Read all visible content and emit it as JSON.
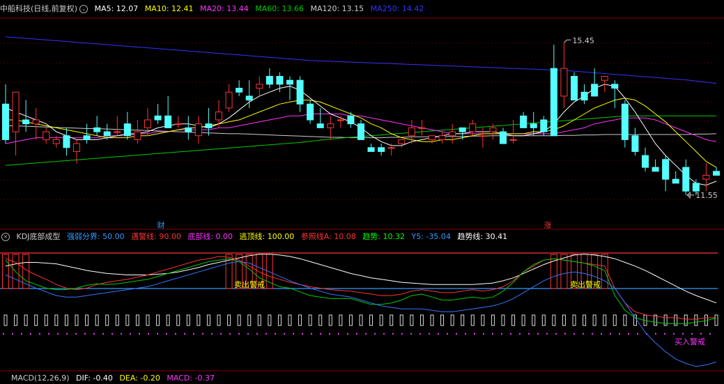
{
  "price_panel": {
    "title": "中船科技(日线,前复权)",
    "ma": [
      {
        "label": "MA5: 12.07",
        "color": "#ffffff"
      },
      {
        "label": "MA10: 12.41",
        "color": "#ffff00"
      },
      {
        "label": "MA20: 13.44",
        "color": "#ff33ff"
      },
      {
        "label": "MA60: 13.66",
        "color": "#00cc00"
      },
      {
        "label": "MA120: 13.15",
        "color": "#cccccc"
      },
      {
        "label": "MA250: 14.42",
        "color": "#3333ff"
      }
    ],
    "high_label": "15.45",
    "low_label": "11.55",
    "event_cai": "财",
    "event_zhang": "涨"
  },
  "kdj_panel": {
    "title": "KDJ底部成型",
    "params": [
      {
        "label": "强弱分界: 50.00",
        "color": "#3399ff"
      },
      {
        "label": "遇警线: 90.00",
        "color": "#ff3333"
      },
      {
        "label": "底部线: 0.00",
        "color": "#ff33ff"
      },
      {
        "label": "逃顶线: 100.00",
        "color": "#ffff00"
      },
      {
        "label": "参照线A: 10.08",
        "color": "#ff3333"
      },
      {
        "label": "趋势: 10.32",
        "color": "#00ff00"
      },
      {
        "label": "Y5: -35.04",
        "color": "#3399ff"
      },
      {
        "label": "趋势线: 30.41",
        "color": "#ffffff"
      }
    ],
    "sell_warn": "卖出警戒",
    "buy_warn": "买入警戒"
  },
  "macd_panel": {
    "title": "MACD(12,26,9)",
    "params": [
      {
        "label": "DIF: -0.40",
        "color": "#ffffff"
      },
      {
        "label": "DEA: -0.20",
        "color": "#ffff00"
      },
      {
        "label": "MACD: -0.37",
        "color": "#ff33ff"
      }
    ]
  },
  "chart_data": {
    "type": "candlestick",
    "price_ylim": [
      11.0,
      16.0
    ],
    "candles": [
      [
        13.9,
        14.4,
        12.9,
        13.0
      ],
      [
        13.2,
        14.2,
        12.6,
        14.2
      ],
      [
        13.5,
        14.0,
        13.2,
        13.4
      ],
      [
        13.4,
        13.8,
        13.0,
        13.5
      ],
      [
        13.0,
        13.3,
        12.9,
        13.2
      ],
      [
        12.9,
        13.1,
        12.8,
        13.0
      ],
      [
        13.1,
        13.3,
        12.6,
        12.8
      ],
      [
        12.7,
        13.0,
        12.4,
        12.9
      ],
      [
        13.1,
        13.4,
        12.9,
        13.0
      ],
      [
        13.3,
        13.6,
        13.1,
        13.2
      ],
      [
        13.2,
        13.4,
        13.0,
        13.1
      ],
      [
        13.2,
        13.6,
        13.1,
        13.2
      ],
      [
        13.4,
        13.7,
        13.0,
        13.1
      ],
      [
        13.0,
        13.5,
        12.9,
        13.2
      ],
      [
        13.3,
        13.8,
        13.1,
        13.5
      ],
      [
        13.6,
        13.9,
        13.4,
        13.5
      ],
      [
        13.6,
        14.1,
        13.4,
        13.3
      ],
      [
        13.4,
        13.6,
        13.3,
        13.4
      ],
      [
        13.3,
        13.6,
        13.0,
        13.2
      ],
      [
        13.1,
        13.6,
        12.9,
        13.4
      ],
      [
        13.4,
        13.8,
        13.1,
        13.3
      ],
      [
        13.5,
        14.0,
        13.3,
        13.7
      ],
      [
        13.8,
        14.4,
        13.7,
        14.2
      ],
      [
        14.3,
        14.5,
        14.1,
        14.2
      ],
      [
        14.1,
        14.5,
        13.8,
        14.0
      ],
      [
        14.3,
        14.6,
        14.1,
        14.4
      ],
      [
        14.6,
        14.8,
        14.3,
        14.4
      ],
      [
        14.6,
        14.7,
        14.2,
        14.4
      ],
      [
        14.5,
        14.6,
        14.0,
        14.4
      ],
      [
        14.5,
        14.6,
        13.7,
        13.9
      ],
      [
        13.9,
        14.0,
        13.4,
        13.5
      ],
      [
        13.4,
        13.8,
        13.3,
        13.3
      ],
      [
        13.3,
        13.6,
        13.0,
        13.4
      ],
      [
        13.5,
        13.6,
        13.3,
        13.5
      ],
      [
        13.6,
        13.7,
        13.3,
        13.4
      ],
      [
        13.4,
        13.5,
        13.0,
        13.0
      ],
      [
        12.8,
        12.9,
        12.7,
        12.7
      ],
      [
        12.8,
        12.9,
        12.6,
        12.7
      ],
      [
        12.8,
        12.9,
        12.6,
        12.8
      ],
      [
        12.9,
        13.0,
        12.8,
        13.0
      ],
      [
        13.1,
        13.5,
        12.9,
        13.3
      ],
      [
        13.3,
        13.5,
        13.1,
        13.3
      ],
      [
        13.0,
        13.1,
        12.9,
        13.1
      ],
      [
        13.0,
        13.2,
        12.9,
        13.1
      ],
      [
        13.1,
        13.4,
        12.9,
        13.2
      ],
      [
        13.3,
        13.3,
        13.0,
        13.2
      ],
      [
        13.2,
        13.5,
        13.1,
        13.4
      ],
      [
        13.1,
        13.3,
        12.8,
        13.1
      ],
      [
        13.2,
        13.4,
        13.0,
        13.3
      ],
      [
        13.2,
        13.3,
        12.9,
        12.9
      ],
      [
        13.0,
        13.5,
        12.9,
        13.0
      ],
      [
        13.6,
        13.7,
        13.3,
        13.3
      ],
      [
        13.4,
        13.7,
        13.1,
        13.3
      ],
      [
        13.5,
        13.6,
        13.1,
        13.2
      ],
      [
        14.8,
        15.4,
        13.2,
        13.1
      ],
      [
        14.1,
        15.45,
        13.8,
        14.8
      ],
      [
        14.6,
        14.7,
        14.0,
        14.0
      ],
      [
        14.2,
        14.4,
        13.9,
        14.0
      ],
      [
        14.4,
        14.8,
        14.1,
        14.1
      ],
      [
        14.5,
        14.6,
        14.2,
        14.6
      ],
      [
        14.4,
        14.5,
        13.8,
        14.3
      ],
      [
        13.9,
        14.0,
        12.8,
        13.0
      ],
      [
        13.1,
        13.3,
        12.6,
        12.7
      ],
      [
        12.6,
        12.8,
        12.2,
        12.3
      ],
      [
        12.3,
        12.5,
        12.2,
        12.2
      ],
      [
        12.5,
        12.6,
        11.7,
        12.0
      ],
      [
        12.0,
        12.2,
        11.9,
        11.9
      ],
      [
        12.3,
        12.5,
        11.6,
        11.7
      ],
      [
        11.9,
        12.0,
        11.6,
        11.7
      ],
      [
        12.0,
        12.4,
        11.7,
        12.1
      ],
      [
        12.2,
        12.3,
        12.1,
        12.1
      ]
    ],
    "ma5": [
      13.8,
      13.7,
      13.6,
      13.5,
      13.4,
      13.2,
      13.1,
      13.0,
      13.0,
      13.0,
      13.05,
      13.1,
      13.15,
      13.15,
      13.2,
      13.3,
      13.35,
      13.4,
      13.4,
      13.35,
      13.3,
      13.4,
      13.55,
      13.75,
      13.95,
      14.1,
      14.2,
      14.3,
      14.35,
      14.25,
      14.05,
      13.85,
      13.65,
      13.55,
      13.45,
      13.3,
      13.1,
      12.95,
      12.85,
      12.85,
      12.95,
      13.0,
      13.05,
      13.1,
      13.15,
      13.15,
      13.2,
      13.2,
      13.2,
      13.15,
      13.1,
      13.1,
      13.15,
      13.2,
      13.4,
      13.7,
      13.95,
      14.1,
      14.3,
      14.4,
      14.35,
      14.05,
      13.7,
      13.3,
      12.9,
      12.6,
      12.35,
      12.1,
      11.9,
      11.85,
      11.95
    ],
    "ma10": [
      13.5,
      13.5,
      13.45,
      13.4,
      13.35,
      13.3,
      13.25,
      13.2,
      13.15,
      13.1,
      13.05,
      13.05,
      13.05,
      13.1,
      13.1,
      13.15,
      13.2,
      13.25,
      13.3,
      13.3,
      13.35,
      13.4,
      13.45,
      13.5,
      13.6,
      13.7,
      13.8,
      13.9,
      13.95,
      14.0,
      14.0,
      13.95,
      13.85,
      13.75,
      13.65,
      13.55,
      13.4,
      13.3,
      13.15,
      13.05,
      13.0,
      12.95,
      12.95,
      13.0,
      13.0,
      13.05,
      13.1,
      13.15,
      13.15,
      13.15,
      13.15,
      13.15,
      13.2,
      13.2,
      13.25,
      13.35,
      13.5,
      13.65,
      13.8,
      13.9,
      14.0,
      14.05,
      14.0,
      13.85,
      13.65,
      13.45,
      13.2,
      12.95,
      12.7,
      12.45,
      12.3
    ],
    "ma20": [
      12.9,
      12.95,
      13.0,
      13.05,
      13.05,
      13.05,
      13.05,
      13.05,
      13.05,
      13.05,
      13.1,
      13.1,
      13.1,
      13.15,
      13.15,
      13.2,
      13.2,
      13.25,
      13.25,
      13.25,
      13.25,
      13.3,
      13.3,
      13.35,
      13.4,
      13.45,
      13.5,
      13.55,
      13.6,
      13.6,
      13.65,
      13.65,
      13.65,
      13.65,
      13.6,
      13.6,
      13.55,
      13.5,
      13.45,
      13.4,
      13.35,
      13.3,
      13.25,
      13.2,
      13.15,
      13.15,
      13.15,
      13.15,
      13.15,
      13.15,
      13.15,
      13.15,
      13.15,
      13.15,
      13.15,
      13.2,
      13.25,
      13.3,
      13.4,
      13.45,
      13.5,
      13.55,
      13.55,
      13.55,
      13.5,
      13.4,
      13.3,
      13.2,
      13.1,
      13.0,
      12.95
    ],
    "ma60": [
      12.35,
      12.37,
      12.39,
      12.41,
      12.43,
      12.45,
      12.47,
      12.49,
      12.51,
      12.53,
      12.55,
      12.57,
      12.59,
      12.61,
      12.63,
      12.65,
      12.67,
      12.69,
      12.71,
      12.73,
      12.75,
      12.77,
      12.79,
      12.81,
      12.83,
      12.85,
      12.87,
      12.89,
      12.91,
      12.93,
      12.96,
      12.99,
      13.01,
      13.04,
      13.06,
      13.08,
      13.1,
      13.12,
      13.14,
      13.16,
      13.18,
      13.2,
      13.22,
      13.24,
      13.26,
      13.28,
      13.3,
      13.32,
      13.34,
      13.36,
      13.38,
      13.4,
      13.42,
      13.44,
      13.46,
      13.48,
      13.5,
      13.52,
      13.54,
      13.56,
      13.58,
      13.6,
      13.6,
      13.6,
      13.6,
      13.6,
      13.6,
      13.6,
      13.6,
      13.6,
      13.6
    ],
    "ma120": [
      13.35,
      13.35,
      13.34,
      13.33,
      13.32,
      13.31,
      13.3,
      13.29,
      13.28,
      13.28,
      13.27,
      13.26,
      13.25,
      13.24,
      13.23,
      13.22,
      13.21,
      13.2,
      13.19,
      13.18,
      13.17,
      13.16,
      13.15,
      13.15,
      13.14,
      13.13,
      13.12,
      13.11,
      13.1,
      13.09,
      13.08,
      13.07,
      13.06,
      13.06,
      13.05,
      13.05,
      13.05,
      13.05,
      13.06,
      13.06,
      13.07,
      13.07,
      13.08,
      13.08,
      13.08,
      13.08,
      13.09,
      13.09,
      13.1,
      13.1,
      13.1,
      13.1,
      13.1,
      13.1,
      13.1,
      13.11,
      13.11,
      13.12,
      13.12,
      13.13,
      13.13,
      13.13,
      13.13,
      13.13,
      13.13,
      13.13,
      13.13,
      13.13,
      13.14,
      13.14,
      13.15
    ],
    "ma250": [
      15.6,
      15.58,
      15.56,
      15.54,
      15.52,
      15.5,
      15.48,
      15.46,
      15.44,
      15.42,
      15.4,
      15.38,
      15.36,
      15.34,
      15.32,
      15.3,
      15.28,
      15.26,
      15.24,
      15.22,
      15.2,
      15.18,
      15.16,
      15.14,
      15.12,
      15.1,
      15.08,
      15.06,
      15.04,
      15.02,
      15.0,
      14.99,
      14.98,
      14.97,
      14.96,
      14.95,
      14.94,
      14.93,
      14.92,
      14.91,
      14.9,
      14.89,
      14.88,
      14.87,
      14.86,
      14.85,
      14.84,
      14.83,
      14.82,
      14.81,
      14.8,
      14.79,
      14.78,
      14.77,
      14.76,
      14.75,
      14.73,
      14.71,
      14.69,
      14.67,
      14.65,
      14.63,
      14.61,
      14.59,
      14.57,
      14.55,
      14.53,
      14.51,
      14.48,
      14.45,
      14.42
    ],
    "kdj_ylim": [
      -60,
      110
    ],
    "kdj_white": [
      80,
      83,
      85,
      85,
      84,
      83,
      80,
      77,
      74,
      72,
      70,
      69,
      68,
      68,
      68,
      69,
      70,
      72,
      75,
      78,
      82,
      85,
      88,
      91,
      94,
      96,
      96,
      95,
      93,
      90,
      86,
      82,
      78,
      74,
      70,
      67,
      64,
      62,
      60,
      58,
      57,
      56,
      55,
      55,
      55,
      55,
      55,
      56,
      57,
      60,
      64,
      70,
      76,
      82,
      87,
      91,
      95,
      96,
      95,
      93,
      90,
      85,
      80,
      74,
      67,
      60,
      53,
      46,
      40,
      35,
      30
    ],
    "kdj_red": [
      90,
      85,
      75,
      68,
      62,
      55,
      50,
      48,
      50,
      55,
      58,
      60,
      62,
      65,
      68,
      72,
      76,
      80,
      84,
      88,
      90,
      93,
      92,
      88,
      80,
      72,
      66,
      62,
      58,
      55,
      52,
      50,
      48,
      47,
      46,
      44,
      42,
      40,
      40,
      42,
      46,
      48,
      46,
      44,
      44,
      46,
      48,
      46,
      48,
      52,
      60,
      72,
      80,
      88,
      90,
      88,
      86,
      84,
      82,
      80,
      50,
      30,
      18,
      14,
      12,
      10,
      10,
      8,
      8,
      10,
      10
    ],
    "kdj_green": [
      88,
      72,
      60,
      55,
      50,
      48,
      48,
      50,
      54,
      56,
      55,
      56,
      58,
      60,
      62,
      66,
      70,
      74,
      78,
      82,
      86,
      88,
      90,
      86,
      76,
      64,
      58,
      52,
      50,
      45,
      40,
      38,
      36,
      36,
      36,
      32,
      28,
      28,
      30,
      34,
      40,
      42,
      38,
      34,
      34,
      36,
      38,
      36,
      38,
      46,
      58,
      72,
      82,
      88,
      90,
      88,
      86,
      84,
      80,
      74,
      40,
      20,
      10,
      6,
      4,
      2,
      2,
      2,
      4,
      6,
      10
    ],
    "kdj_blue": [
      68,
      62,
      56,
      50,
      45,
      40,
      38,
      38,
      40,
      42,
      44,
      46,
      48,
      50,
      52,
      56,
      60,
      64,
      68,
      72,
      76,
      80,
      84,
      86,
      84,
      78,
      72,
      66,
      60,
      55,
      50,
      46,
      42,
      40,
      38,
      34,
      30,
      26,
      24,
      22,
      22,
      22,
      20,
      18,
      18,
      20,
      22,
      24,
      26,
      30,
      36,
      44,
      52,
      60,
      66,
      70,
      72,
      70,
      66,
      60,
      50,
      30,
      10,
      -10,
      -24,
      -36,
      -46,
      -52,
      -56,
      -54,
      -50
    ]
  }
}
